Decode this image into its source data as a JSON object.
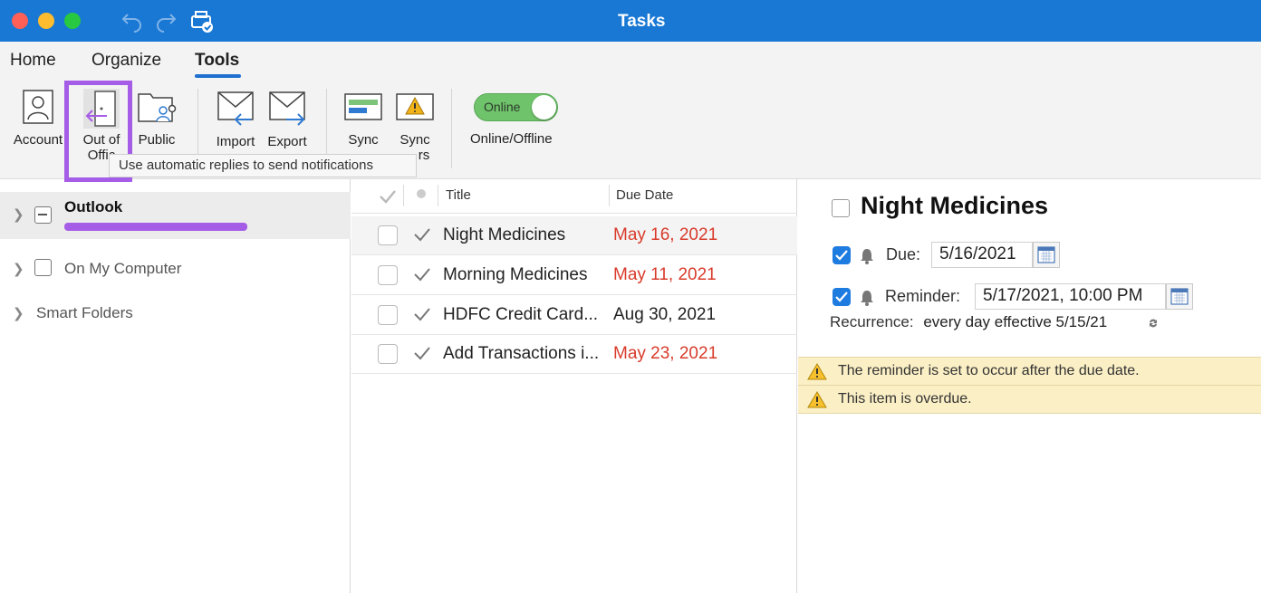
{
  "window": {
    "title": "Tasks"
  },
  "ribbon": {
    "tabs": [
      {
        "label": "Home"
      },
      {
        "label": "Organize"
      },
      {
        "label": "Tools"
      }
    ],
    "buttons": {
      "accounts": "Account",
      "out_of_office_line1": "Out of",
      "out_of_office_line2": "Offic",
      "public": "Public",
      "import": "Import",
      "export": "Export",
      "sync1": "Sync",
      "sync2": "Sync",
      "sync2_line2": "rs"
    },
    "tooltip": "Use automatic replies to send notifications",
    "toggle": {
      "state_text": "Online",
      "label": "Online/Offline",
      "on_color": "#6fc36a"
    }
  },
  "sidebar": {
    "items": [
      {
        "label": "Outlook"
      },
      {
        "label": "On My Computer"
      },
      {
        "label": "Smart Folders"
      }
    ]
  },
  "task_list": {
    "columns": {
      "title": "Title",
      "due": "Due Date"
    },
    "rows": [
      {
        "title": "Night Medicines",
        "due": "May 16, 2021",
        "overdue": true
      },
      {
        "title": "Morning Medicines",
        "due": "May 11, 2021",
        "overdue": true
      },
      {
        "title": "HDFC Credit Card...",
        "due": "Aug 30, 2021",
        "overdue": false
      },
      {
        "title": "Add Transactions i...",
        "due": "May 23, 2021",
        "overdue": true
      }
    ]
  },
  "detail": {
    "title": "Night Medicines",
    "due_label": "Due:",
    "due_value": "5/16/2021",
    "reminder_label": "Reminder:",
    "reminder_value": "5/17/2021, 10:00 PM",
    "recurrence_label": "Recurrence:",
    "recurrence_value": "every day effective 5/15/21",
    "warnings": [
      "The reminder is set to occur after the due date.",
      "This item is overdue."
    ]
  },
  "colors": {
    "titlebar": "#1878d4",
    "highlight": "#a55ce6",
    "overdue": "#d83b2b",
    "warning_bg": "#fbefc5"
  }
}
